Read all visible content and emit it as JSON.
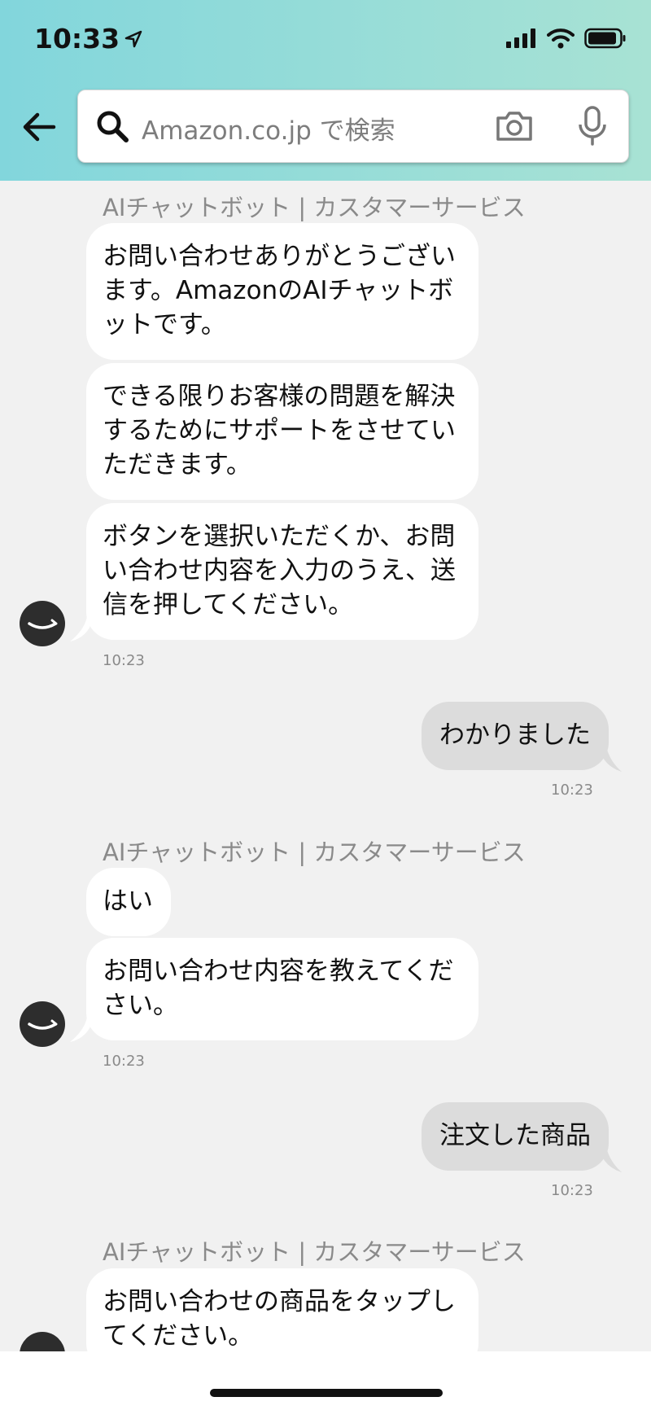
{
  "status": {
    "time": "10:33"
  },
  "search": {
    "placeholder": "Amazon.co.jp で検索"
  },
  "chat": {
    "sender_label": "AIチャットボット | カスタマーサービス",
    "group1": {
      "messages": [
        "お問い合わせありがとうございます。AmazonのAIチャットボットです。",
        "できる限りお客様の問題を解決するためにサポートをさせていただきます。",
        "ボタンを選択いただくか、お問い合わせ内容を入力のうえ、送信を押してください。"
      ],
      "time": "10:23"
    },
    "user1": {
      "message": "わかりました",
      "time": "10:23"
    },
    "group2": {
      "messages": [
        "はい",
        "お問い合わせ内容を教えてください。"
      ],
      "time": "10:23"
    },
    "user2": {
      "message": "注文した商品",
      "time": "10:23"
    },
    "group3": {
      "messages": [
        "お問い合わせの商品をタップしてください。"
      ]
    }
  }
}
